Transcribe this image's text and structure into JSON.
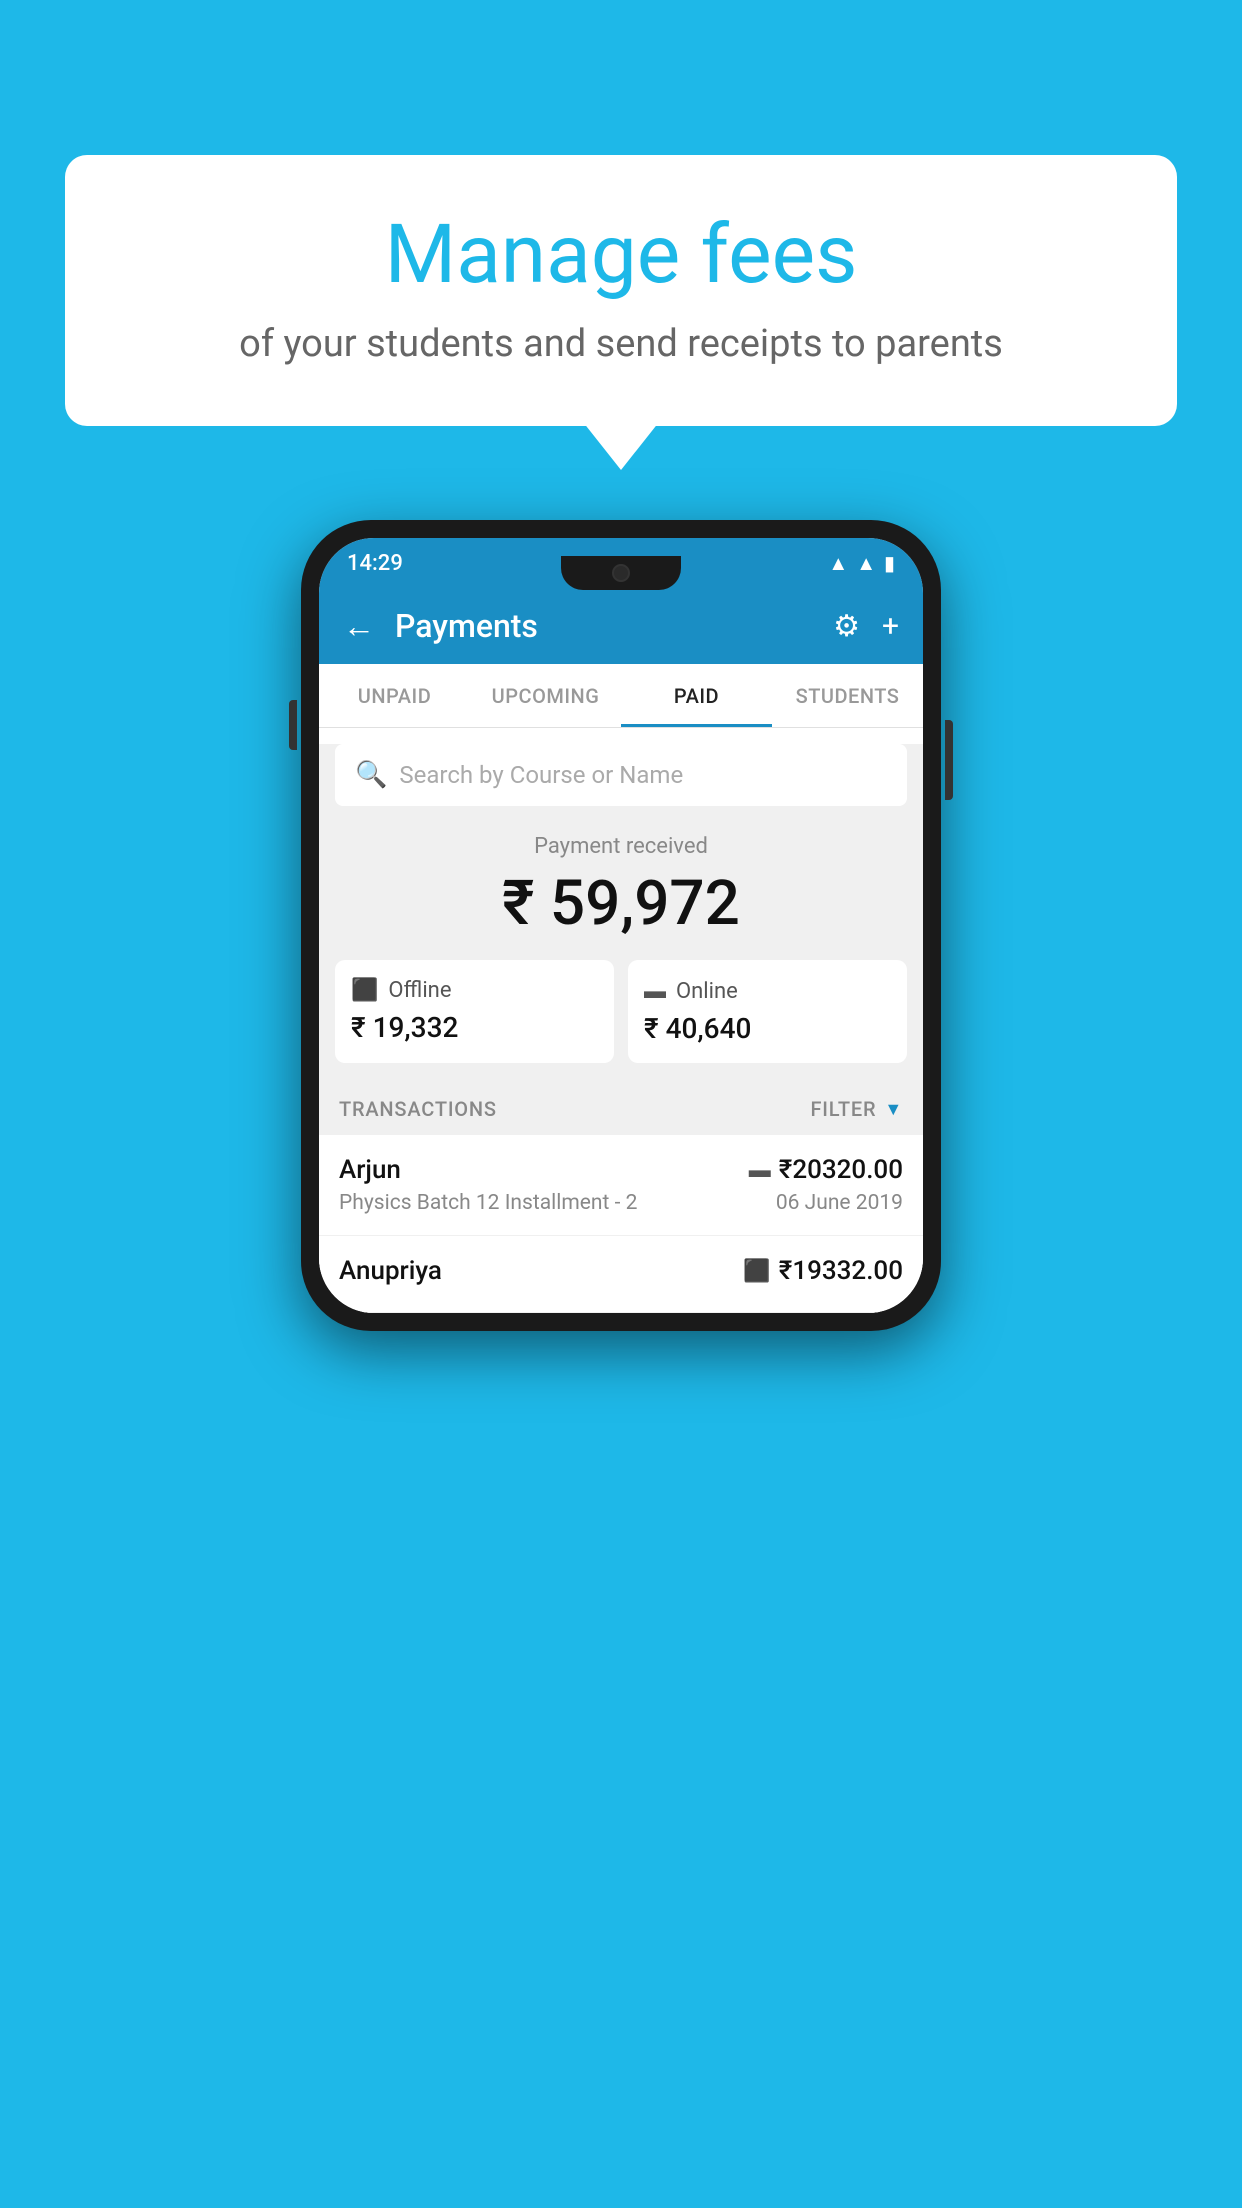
{
  "page": {
    "background_color": "#1eb8e8"
  },
  "speech_bubble": {
    "title": "Manage fees",
    "subtitle": "of your students and send receipts to parents"
  },
  "status_bar": {
    "time": "14:29",
    "wifi_icon": "wifi",
    "signal_icon": "signal",
    "battery_icon": "battery"
  },
  "app_bar": {
    "title": "Payments",
    "back_icon": "←",
    "settings_icon": "⚙",
    "add_icon": "+"
  },
  "tabs": [
    {
      "label": "UNPAID",
      "active": false
    },
    {
      "label": "UPCOMING",
      "active": false
    },
    {
      "label": "PAID",
      "active": true
    },
    {
      "label": "STUDENTS",
      "active": false
    }
  ],
  "search": {
    "placeholder": "Search by Course or Name"
  },
  "payment_summary": {
    "label": "Payment received",
    "amount": "₹ 59,972"
  },
  "payment_cards": [
    {
      "label": "Offline",
      "amount": "₹ 19,332",
      "icon": "offline"
    },
    {
      "label": "Online",
      "amount": "₹ 40,640",
      "icon": "online"
    }
  ],
  "transactions": {
    "header_label": "TRANSACTIONS",
    "filter_label": "FILTER"
  },
  "transaction_rows": [
    {
      "name": "Arjun",
      "amount": "₹20320.00",
      "payment_type": "online",
      "course": "Physics Batch 12 Installment - 2",
      "date": "06 June 2019"
    },
    {
      "name": "Anupriya",
      "amount": "₹19332.00",
      "payment_type": "offline",
      "course": "",
      "date": ""
    }
  ]
}
